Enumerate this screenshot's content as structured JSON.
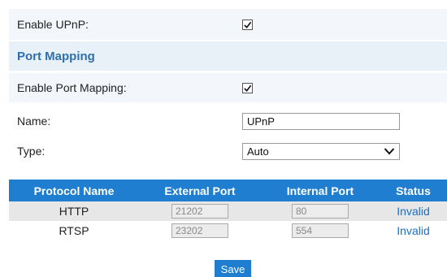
{
  "upnp": {
    "enable_label": "Enable UPnP:",
    "enabled": true
  },
  "port_mapping": {
    "section_title": "Port Mapping",
    "enable_label": "Enable Port Mapping:",
    "enabled": true,
    "name_label": "Name:",
    "name_value": "UPnP",
    "type_label": "Type:",
    "type_value": "Auto"
  },
  "table": {
    "headers": [
      "Protocol Name",
      "External Port",
      "Internal Port",
      "Status"
    ],
    "rows": [
      {
        "protocol": "HTTP",
        "external": "21202",
        "internal": "80",
        "status": "Invalid"
      },
      {
        "protocol": "RTSP",
        "external": "23202",
        "internal": "554",
        "status": "Invalid"
      }
    ]
  },
  "actions": {
    "save_label": "Save"
  },
  "colors": {
    "accent": "#1f7ed0",
    "section_title": "#2f6fae",
    "status_link": "#1f6fc0"
  }
}
